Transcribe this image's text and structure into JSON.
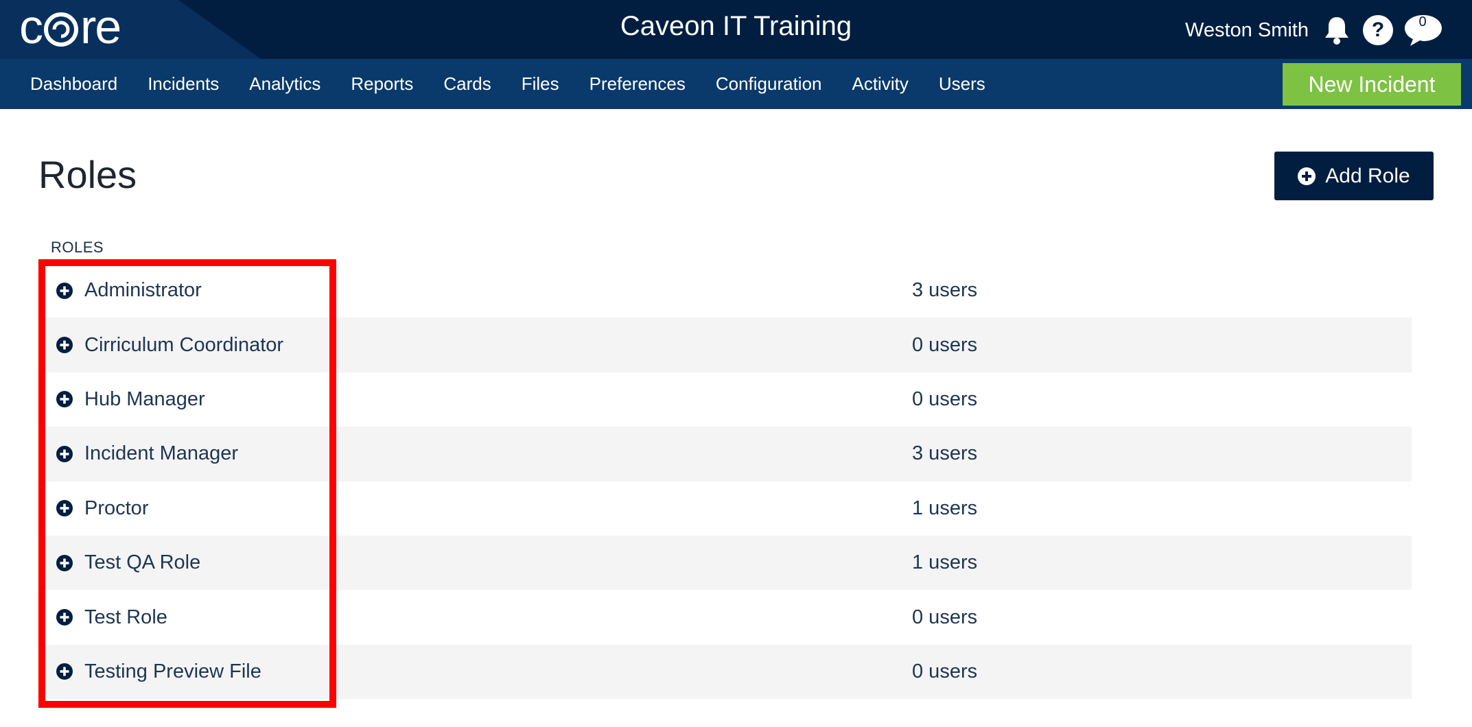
{
  "header": {
    "logo_text_left": "c",
    "logo_text_right": "re",
    "app_title": "Caveon IT Training",
    "user_name": "Weston Smith",
    "help_label": "?",
    "chat_count": "0",
    "icons": {
      "notifications": "bell-icon",
      "help": "question-circle-icon",
      "chat": "chat-bubble-icon"
    }
  },
  "nav": {
    "items": [
      {
        "label": "Dashboard"
      },
      {
        "label": "Incidents"
      },
      {
        "label": "Analytics"
      },
      {
        "label": "Reports"
      },
      {
        "label": "Cards"
      },
      {
        "label": "Files"
      },
      {
        "label": "Preferences"
      },
      {
        "label": "Configuration"
      },
      {
        "label": "Activity"
      },
      {
        "label": "Users"
      }
    ],
    "new_incident_label": "New Incident"
  },
  "main": {
    "title": "Roles",
    "add_role_label": "Add Role",
    "section_label": "ROLES",
    "roles": [
      {
        "name": "Administrator",
        "users": "3 users"
      },
      {
        "name": "Cirriculum Coordinator",
        "users": "0 users"
      },
      {
        "name": "Hub Manager",
        "users": "0 users"
      },
      {
        "name": "Incident Manager",
        "users": "3 users"
      },
      {
        "name": "Proctor",
        "users": "1 users"
      },
      {
        "name": "Test QA Role",
        "users": "1 users"
      },
      {
        "name": "Test Role",
        "users": "0 users"
      },
      {
        "name": "Testing Preview File",
        "users": "0 users"
      }
    ]
  },
  "colors": {
    "header_bg": "#011e41",
    "nav_bg": "#0a3a6b",
    "accent_green": "#7dc242",
    "highlight": "#ff0000"
  }
}
